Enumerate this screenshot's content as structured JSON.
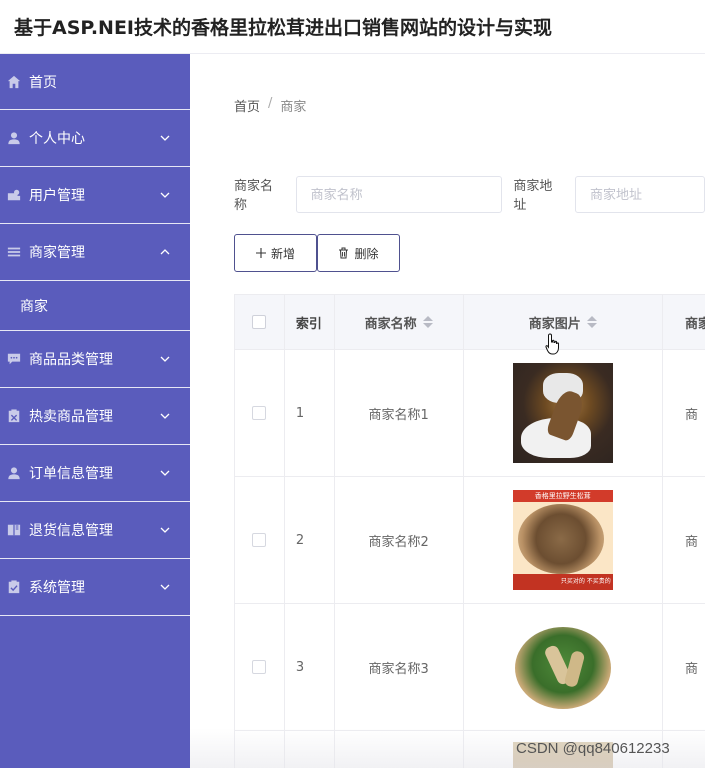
{
  "header": {
    "title": "基于ASP.NEI技术的香格里拉松茸进出口销售网站的设计与实现"
  },
  "sidebar": {
    "items": [
      {
        "label": "首页",
        "icon": "home-icon",
        "expandable": false
      },
      {
        "label": "个人中心",
        "icon": "user-icon",
        "expandable": true
      },
      {
        "label": "用户管理",
        "icon": "user-manage-icon",
        "expandable": true
      },
      {
        "label": "商家管理",
        "icon": "list-icon",
        "expandable": true,
        "expanded": true,
        "children": [
          "商家"
        ]
      },
      {
        "label": "商品品类管理",
        "icon": "chat-icon",
        "expandable": true
      },
      {
        "label": "热卖商品管理",
        "icon": "clipboard-x-icon",
        "expandable": true
      },
      {
        "label": "订单信息管理",
        "icon": "user-icon",
        "expandable": true
      },
      {
        "label": "退货信息管理",
        "icon": "book-icon",
        "expandable": true
      },
      {
        "label": "系统管理",
        "icon": "clipboard-check-icon",
        "expandable": true
      }
    ],
    "sub_label": "商家"
  },
  "breadcrumb": {
    "home": "首页",
    "sep": "/",
    "current": "商家"
  },
  "search": {
    "name_label": "商家名称",
    "name_placeholder": "商家名称",
    "addr_label": "商家地址",
    "addr_placeholder": "商家地址"
  },
  "toolbar": {
    "add_label": "新增",
    "delete_label": "删除"
  },
  "table": {
    "headers": {
      "index": "索引",
      "name": "商家名称",
      "image": "商家图片",
      "addr": "商家"
    },
    "rows": [
      {
        "index": "1",
        "name": "商家名称1",
        "addr": "商"
      },
      {
        "index": "2",
        "name": "商家名称2",
        "addr": "商"
      },
      {
        "index": "3",
        "name": "商家名称3",
        "addr": "商"
      }
    ]
  },
  "image_texts": {
    "row2_banner": "香格里拉野生松茸",
    "row2_footer": "只买对的 不买贵的"
  },
  "watermark": "CSDN @qq840612233",
  "colors": {
    "sidebar_bg": "#5a5cbc",
    "button_border": "#4f518f",
    "header_bg": "#f5f6fa"
  }
}
